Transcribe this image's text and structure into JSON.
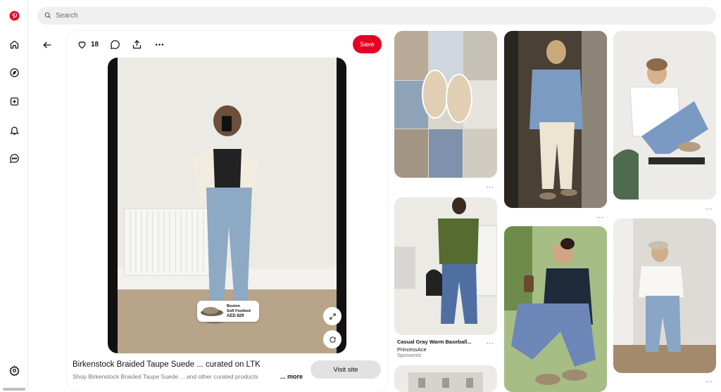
{
  "search": {
    "placeholder": "Search"
  },
  "rail": {
    "icons": [
      "pinterest-logo",
      "home-icon",
      "explore-icon",
      "create-icon",
      "notifications-icon",
      "messages-icon",
      "settings-icon"
    ]
  },
  "pin": {
    "like_count": "18",
    "save_label": "Save",
    "product_tag": {
      "line1": "Boston",
      "line2": "Soft Footbed",
      "price": "AED 829"
    },
    "title": "Birkenstock Braided Taupe Suede ... curated on LTK",
    "description": "Shop Birkenstock Braided Taupe Suede ... and other curated products",
    "more_label": "... more",
    "visit_label": "Visit site"
  },
  "grid": {
    "dots": "...",
    "sponsored_pin": {
      "title": "Casual Gray Warm Baseball...",
      "author": "PrincessAce",
      "sponsored": "Sponsored"
    }
  },
  "colors": {
    "brand": "#e60023",
    "search_bg": "#efefef",
    "visit_bg": "#e2e2e2"
  }
}
